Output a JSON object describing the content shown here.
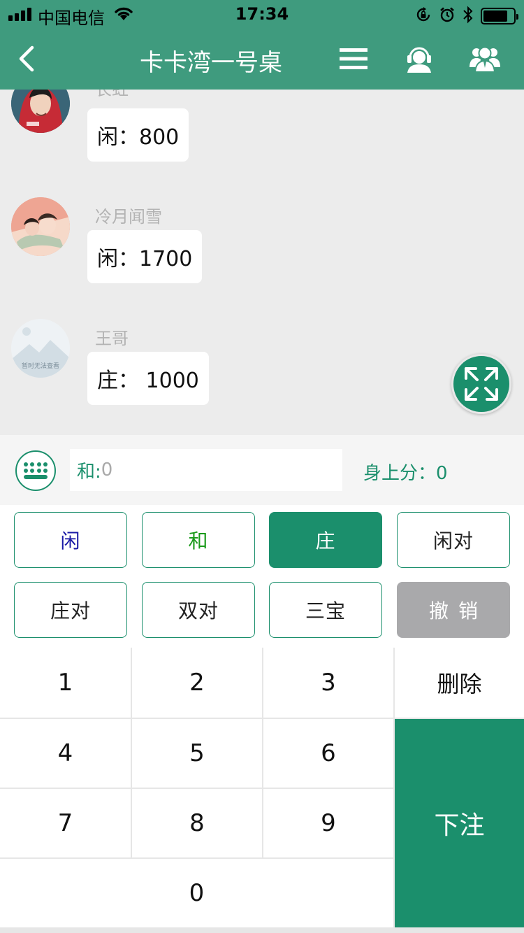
{
  "status_bar": {
    "carrier": "中国电信",
    "time": "17:34",
    "signal_bars": 4,
    "battery_level": 0.8
  },
  "nav": {
    "title": "卡卡湾一号桌",
    "icons": [
      "chevron-left-icon",
      "menu-icon",
      "customer-service-icon",
      "group-icon"
    ]
  },
  "messages": [
    {
      "sender": "长虹",
      "text": "闲：800"
    },
    {
      "sender": "冷月闻雪",
      "text": "闲：1700"
    },
    {
      "sender": "王哥",
      "text": "庄： 1000",
      "avatar_caption": "暂时无法查看"
    }
  ],
  "input": {
    "prefix": "和:",
    "placeholder": "0",
    "balance_label": "身上分：0"
  },
  "bet_options": [
    {
      "label": "闲",
      "color": "#1a1aa6",
      "active": false
    },
    {
      "label": "和",
      "color": "#1a9a1a",
      "active": false
    },
    {
      "label": "庄",
      "color": "#ffffff",
      "active": true
    },
    {
      "label": "闲对",
      "color": "#222222",
      "active": false
    },
    {
      "label": "庄对",
      "color": "#222222",
      "active": false
    },
    {
      "label": "双对",
      "color": "#222222",
      "active": false
    },
    {
      "label": "三宝",
      "color": "#222222",
      "active": false
    },
    {
      "label": "撤销",
      "color": "#ffffff",
      "active": false
    }
  ],
  "keypad": {
    "digits": [
      "1",
      "2",
      "3",
      "4",
      "5",
      "6",
      "7",
      "8",
      "9",
      "0"
    ],
    "delete_label": "删除",
    "submit_label": "下注"
  },
  "colors": {
    "header": "#3f9b7e",
    "accent": "#1b8f6c",
    "undo": "#a9a9ab"
  }
}
